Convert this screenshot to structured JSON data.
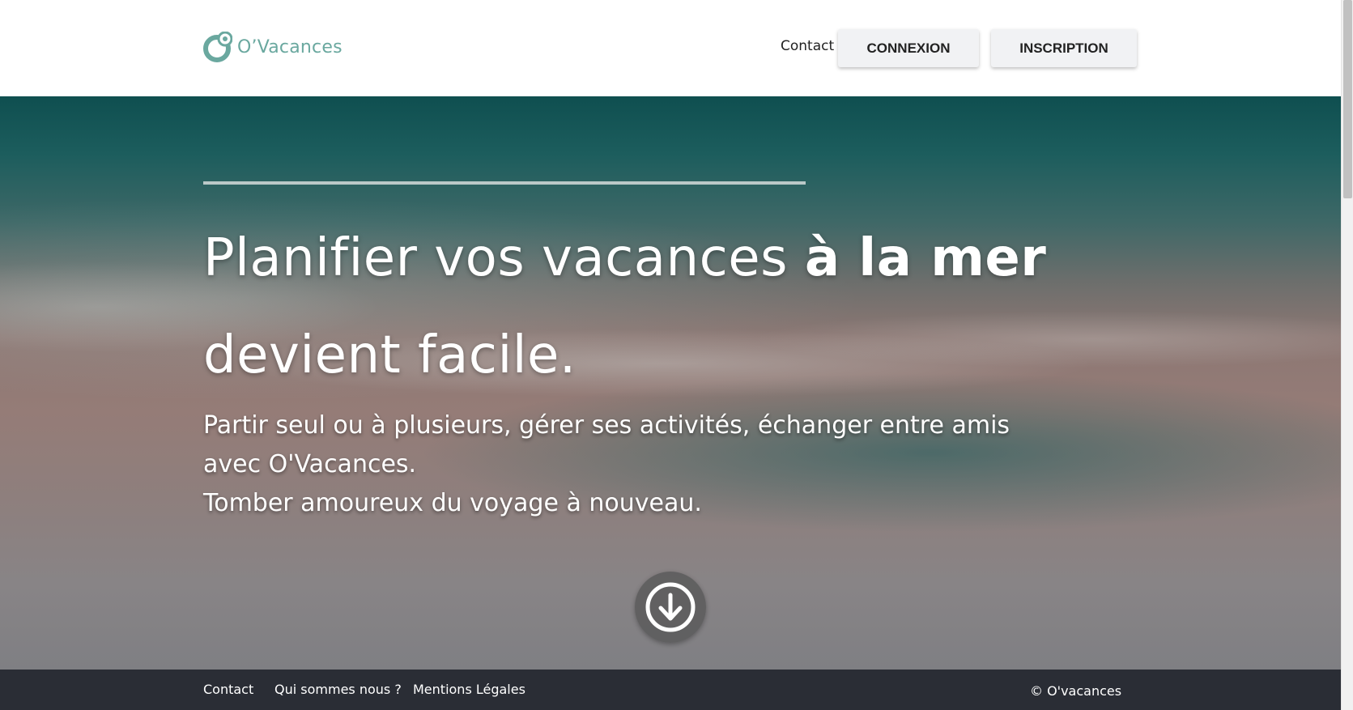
{
  "header": {
    "logo_text": "O’Vacances",
    "nav_contact": "Contact",
    "login_button": "CONNEXION",
    "signup_button": "INSCRIPTION"
  },
  "hero": {
    "title_part1": "Planifier vos vacances ",
    "title_bold": "à la mer",
    "title_part2": "devient facile.",
    "subtitle_line1": "Partir seul ou à plusieurs, gérer ses activités, échanger entre amis avec O'Vacances.",
    "subtitle_line2": "Tomber amoureux du voyage à nouveau."
  },
  "scroll_icon": "arrow-down-circle-icon",
  "footer": {
    "links": [
      "Contact",
      "Qui sommes nous ?",
      "Mentions Légales"
    ],
    "copyright": "© O'vacances"
  },
  "colors": {
    "brand": "#6aa89f",
    "footer_bg": "#2a2d35",
    "button_bg": "#f1f2f4"
  }
}
